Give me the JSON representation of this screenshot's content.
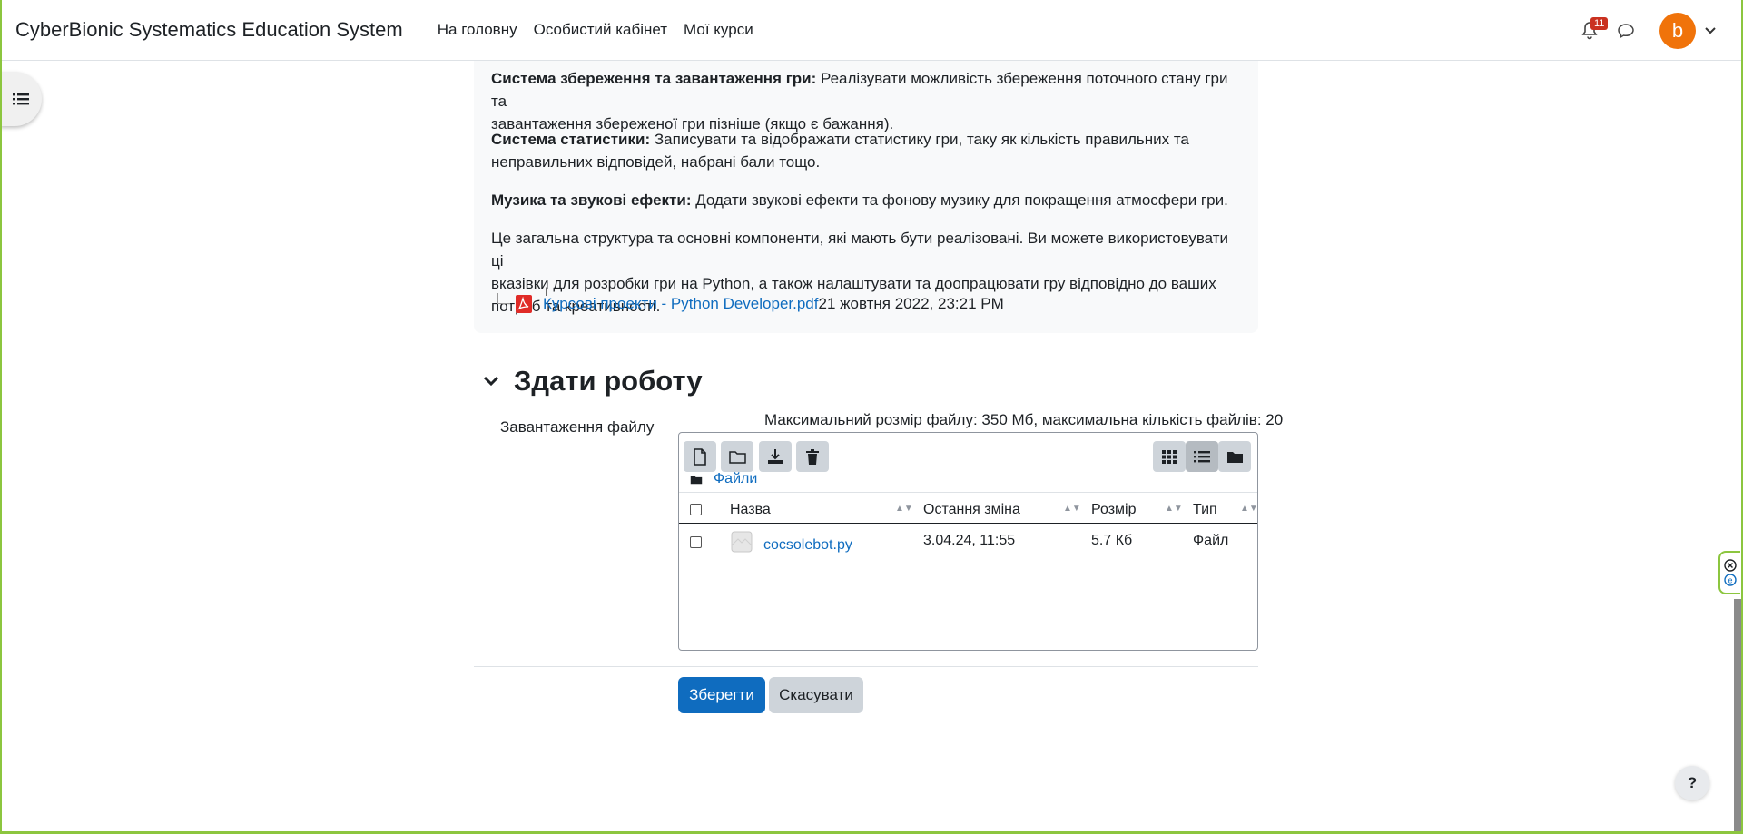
{
  "navbar": {
    "brand": "CyberBionic Systematics Education System",
    "links": [
      "На головну",
      "Особистий кабінет",
      "Мої курси"
    ],
    "notification_count": "11",
    "avatar_letter": "b"
  },
  "intro": {
    "p1_bold": "Система збереження та завантаження гри:",
    "p1_line1": " Реалізувати можливість збереження поточного стану гри та",
    "p1_line2": "завантаження збереженої гри пізніше (якщо є бажання).",
    "p2_bold": "Система статистики:",
    "p2_line1": " Записувати та відображати статистику гри, таку як кількість правильних та",
    "p2_line2": "неправильних відповідей, набрані бали тощо.",
    "p3_bold": "Музика та звукові ефекти:",
    "p3_line1": " Додати звукові ефекти та фонову музику для покращення атмосфери гри.",
    "p4_line1": "Це загальна структура та основні компоненти, які мають бути реалізовані. Ви можете використовувати ці",
    "p4_line2": "вказівки для розробки гри на Python, а також налаштувати та доопрацювати гру відповідно до ваших",
    "p4_line3": "потреб та креативності.",
    "attachment_name": "Курсові проекти - Python Developer.pdf",
    "attachment_date": "21 жовтня 2022, 23:21 PM"
  },
  "submission": {
    "title": "Здати роботу",
    "field_label": "Завантаження файлу",
    "limits": "Максимальний розмір файлу: 350 Мб, максимальна кількість файлів: 20",
    "path_label": "Файли",
    "columns": [
      "Назва",
      "Остання зміна",
      "Розмір",
      "Тип"
    ],
    "files": [
      {
        "name": "cocsolebot.py",
        "modified": "3.04.24, 11:55",
        "size": "5.7 Кб",
        "type": "Файл"
      }
    ],
    "save_label": "Зберегти",
    "cancel_label": "Скасувати"
  },
  "help_label": "?",
  "colors": {
    "accent": "#0f6cbf",
    "avatar": "#f0730a",
    "frame": "#8cc63f",
    "badge": "#ca3120"
  }
}
